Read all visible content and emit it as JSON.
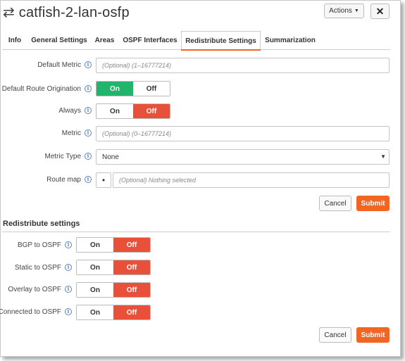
{
  "header": {
    "title": "catfish-2-lan-osfp",
    "title_icon": "transfer-arrows-icon",
    "actions_label": "Actions",
    "close_label": "✕"
  },
  "tabs": [
    {
      "label": "Info",
      "active": false
    },
    {
      "label": "General Settings",
      "active": false
    },
    {
      "label": "Areas",
      "active": false
    },
    {
      "label": "OSPF Interfaces",
      "active": false
    },
    {
      "label": "Redistribute Settings",
      "active": true
    },
    {
      "label": "Summarization",
      "active": false
    }
  ],
  "form": {
    "default_metric": {
      "label": "Default Metric",
      "value": "",
      "placeholder": "(Optional) (1–16777214)"
    },
    "default_route_origination": {
      "label": "Default Route Origination",
      "on": "On",
      "off": "Off",
      "selected": "On"
    },
    "always": {
      "label": "Always",
      "on": "On",
      "off": "Off",
      "selected": "Off"
    },
    "metric": {
      "label": "Metric",
      "value": "",
      "placeholder": "(Optional) (0–16777214)"
    },
    "metric_type": {
      "label": "Metric Type",
      "selected": "None"
    },
    "route_map": {
      "label": "Route map",
      "dot": "•",
      "placeholder": "(Optional) Nothing selected"
    },
    "cancel_label": "Cancel",
    "submit_label": "Submit"
  },
  "redistribute": {
    "title": "Redistribute settings",
    "items": [
      {
        "label": "BGP to OSPF",
        "on": "On",
        "off": "Off",
        "selected": "Off"
      },
      {
        "label": "Static to OSPF",
        "on": "On",
        "off": "Off",
        "selected": "Off"
      },
      {
        "label": "Overlay to OSPF",
        "on": "On",
        "off": "Off",
        "selected": "Off"
      },
      {
        "label": "Connected to OSPF",
        "on": "On",
        "off": "Off",
        "selected": "Off"
      }
    ],
    "cancel_label": "Cancel",
    "submit_label": "Submit"
  },
  "colors": {
    "accent": "#f26522",
    "on_green": "#20b56b",
    "off_red": "#e8503a"
  }
}
